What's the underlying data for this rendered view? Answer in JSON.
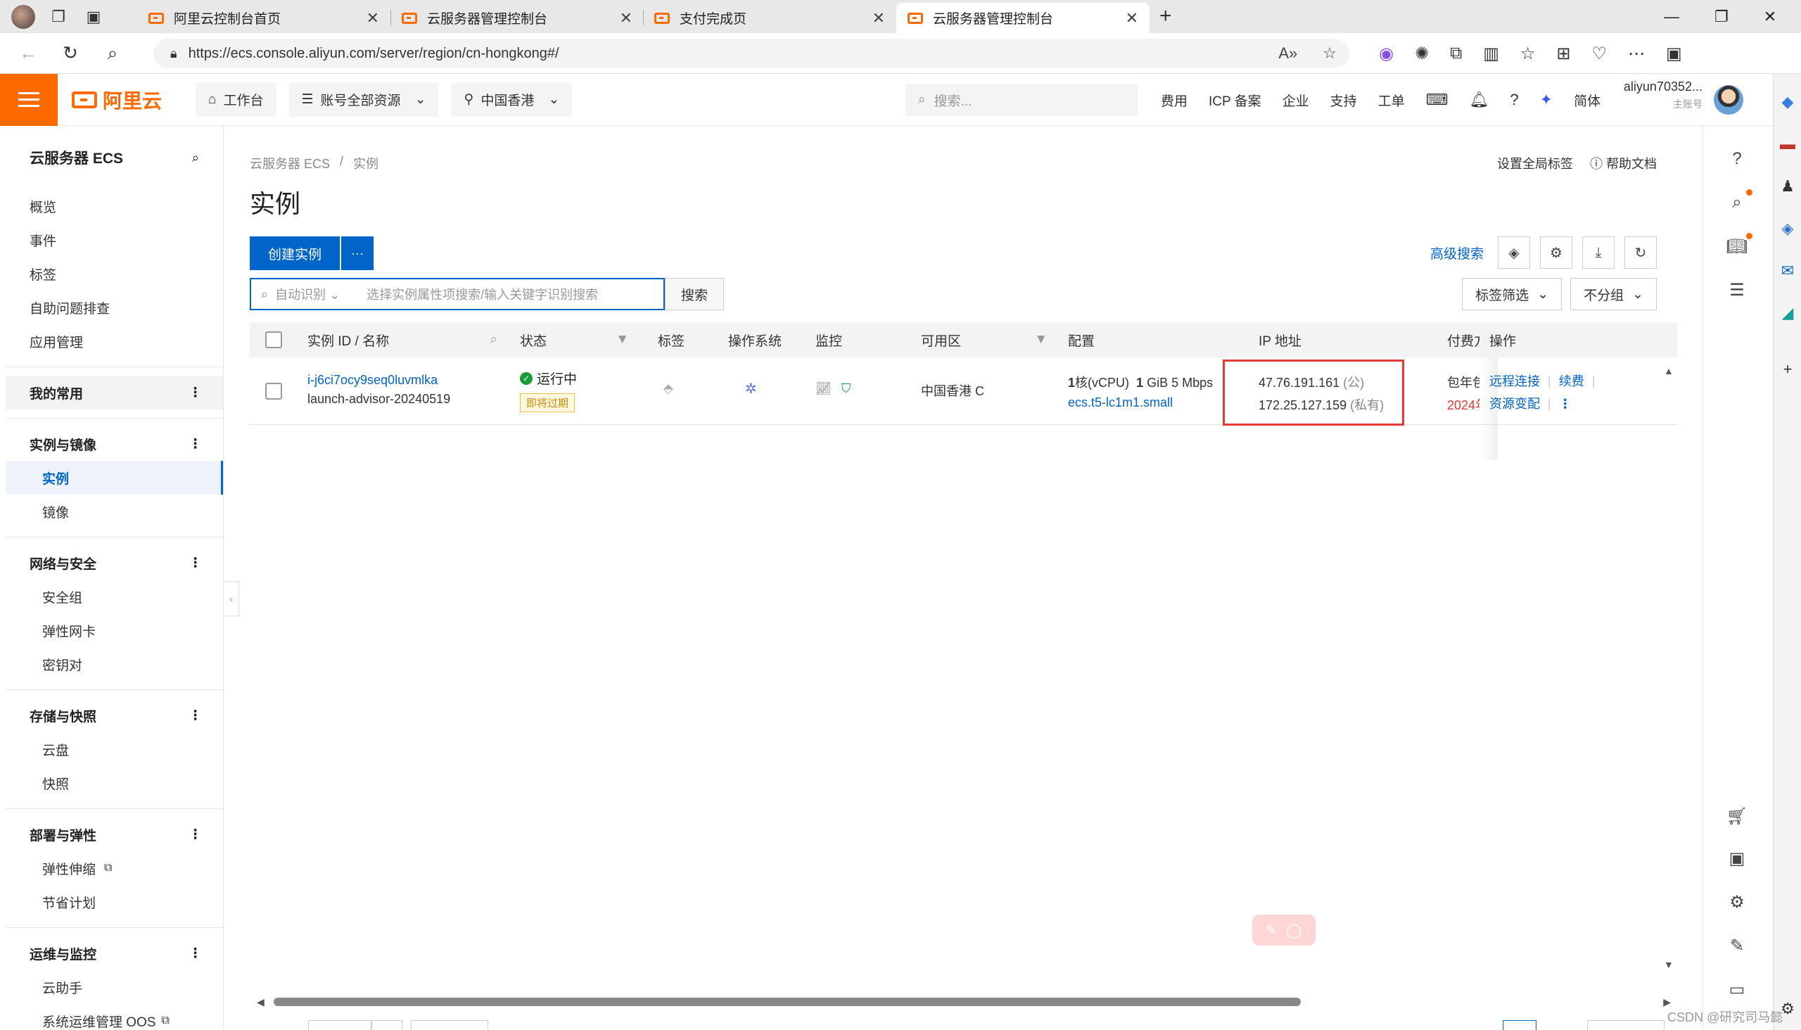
{
  "browser": {
    "tabs": [
      {
        "label": "阿里云控制台首页"
      },
      {
        "label": "云服务器管理控制台"
      },
      {
        "label": "支付完成页"
      },
      {
        "label": "云服务器管理控制台"
      }
    ],
    "url": "https://ecs.console.aliyun.com/server/region/cn-hongkong#/",
    "new_tab": "+"
  },
  "topnav": {
    "logo_text": "阿里云",
    "workbench": "工作台",
    "resources": "账号全部资源",
    "region": "中国香港",
    "search_placeholder": "搜索...",
    "links": [
      "费用",
      "ICP 备案",
      "企业",
      "支持",
      "工单"
    ],
    "lang": "简体",
    "account_name": "aliyun70352...",
    "account_sub": "主账号"
  },
  "sidebar": {
    "title": "云服务器 ECS",
    "items": [
      "概览",
      "事件",
      "标签",
      "自助问题排查",
      "应用管理"
    ],
    "favorites": "我的常用",
    "groups": [
      {
        "label": "实例与镜像",
        "items": [
          "实例",
          "镜像"
        ]
      },
      {
        "label": "网络与安全",
        "items": [
          "安全组",
          "弹性网卡",
          "密钥对"
        ]
      },
      {
        "label": "存储与快照",
        "items": [
          "云盘",
          "快照"
        ]
      },
      {
        "label": "部署与弹性",
        "items": [
          "弹性伸缩",
          "节省计划"
        ]
      },
      {
        "label": "运维与监控",
        "items": [
          "云助手",
          "系统运维管理 OOS"
        ]
      }
    ]
  },
  "main": {
    "breadcrumb": [
      "云服务器 ECS",
      "/",
      "实例"
    ],
    "title": "实例",
    "set_tags": "设置全局标签",
    "help_docs": "帮助文档",
    "create_btn": "创建实例",
    "more_btn": "···",
    "advanced_search": "高级搜索",
    "search_auto": "自动识别",
    "search_placeholder": "选择实例属性项搜索/输入关键字识别搜索",
    "search_btn": "搜索",
    "tag_filter": "标签筛选",
    "group_by": "不分组",
    "columns": [
      "实例 ID / 名称",
      "状态",
      "标签",
      "操作系统",
      "监控",
      "可用区",
      "配置",
      "IP 地址",
      "付费方",
      "操作"
    ],
    "row": {
      "instance_id": "i-j6ci7ocy9seq0luvmlka",
      "instance_name": "launch-advisor-20240519",
      "status": "运行中",
      "status_tag": "即将过期",
      "zone": "中国香港 C",
      "config_cpu": "1",
      "config_cpu_unit": "核(vCPU)",
      "config_mem": "1",
      "config_mem_unit": "GiB 5 Mbps",
      "config_type": "ecs.t5-lc1m1.small",
      "ip_public": "47.76.191.161",
      "ip_public_tag": "(公)",
      "ip_private": "172.25.127.159",
      "ip_private_tag": "(私有)",
      "pay_type": "包年包",
      "pay_date": "2024年",
      "actions": [
        "远程连接",
        "续费",
        "资源变配"
      ]
    }
  },
  "watermark": "CSDN @研究司马懿"
}
